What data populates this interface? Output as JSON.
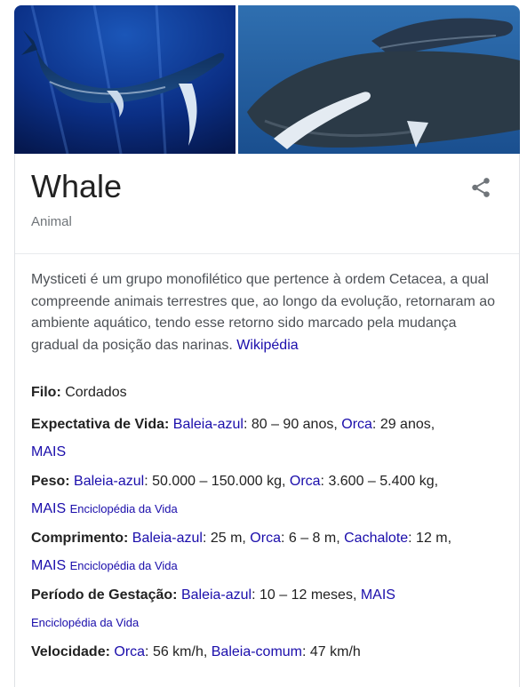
{
  "entity": {
    "title": "Whale",
    "subtitle": "Animal"
  },
  "images": [
    {
      "name": "humpback-whale-blue-water-image"
    },
    {
      "name": "humpback-whale-with-calf-image"
    }
  ],
  "description": {
    "text": "Mysticeti é um grupo monofilético que pertence à ordem Cetacea, a qual compreende animais terrestres que, ao longo da evolução, retornaram ao ambiente aquático, tendo esse retorno sido marcado pela mudança gradual da posição das narinas.",
    "source": "Wikipédia"
  },
  "facts": {
    "filo": {
      "label": "Filo:",
      "value": "Cordados"
    },
    "vida": {
      "label": "Expectativa de Vida:",
      "link1": "Baleia-azul",
      "val1": ": 80 – 90 anos, ",
      "link2": "Orca",
      "val2": ": 29 anos,",
      "more": "MAIS"
    },
    "peso": {
      "label": "Peso:",
      "link1": "Baleia-azul",
      "val1": ": 50.000 – 150.000 kg, ",
      "link2": "Orca",
      "val2": ": 3.600 – 5.400 kg,",
      "more": "MAIS",
      "source": "Enciclopédia da Vida"
    },
    "comprimento": {
      "label": "Comprimento:",
      "link1": "Baleia-azul",
      "val1": ": 25 m, ",
      "link2": "Orca",
      "val2": ": 6 – 8 m, ",
      "link3": "Cachalote",
      "val3": ": 12 m,",
      "more": "MAIS",
      "source": "Enciclopédia da Vida"
    },
    "gestacao": {
      "label": "Período de Gestação:",
      "link1": "Baleia-azul",
      "val1": ": 10 – 12 meses, ",
      "more": "MAIS",
      "source": "Enciclopédia da Vida"
    },
    "velocidade": {
      "label": "Velocidade:",
      "link1": "Orca",
      "val1": ": 56 km/h, ",
      "link2": "Baleia-comum",
      "val2": ": 47 km/h"
    }
  },
  "colors": {
    "link": "#1a0dab",
    "text": "#222222",
    "muted": "#70757a"
  },
  "icons": {
    "share": "share-icon"
  }
}
